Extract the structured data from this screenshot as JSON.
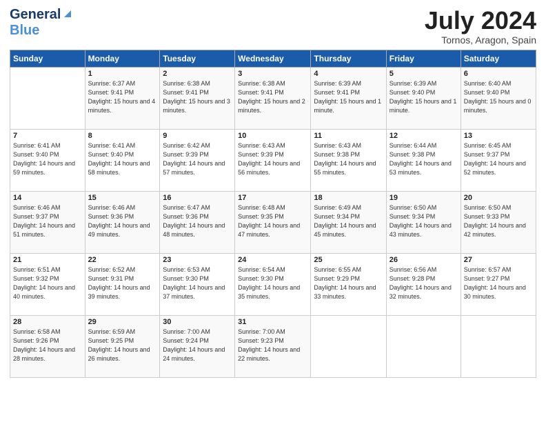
{
  "header": {
    "logo_general": "General",
    "logo_blue": "Blue",
    "month_title": "July 2024",
    "location": "Tornos, Aragon, Spain"
  },
  "days_of_week": [
    "Sunday",
    "Monday",
    "Tuesday",
    "Wednesday",
    "Thursday",
    "Friday",
    "Saturday"
  ],
  "weeks": [
    [
      {
        "day": "",
        "sunrise": "",
        "sunset": "",
        "daylight": ""
      },
      {
        "day": "1",
        "sunrise": "Sunrise: 6:37 AM",
        "sunset": "Sunset: 9:41 PM",
        "daylight": "Daylight: 15 hours and 4 minutes."
      },
      {
        "day": "2",
        "sunrise": "Sunrise: 6:38 AM",
        "sunset": "Sunset: 9:41 PM",
        "daylight": "Daylight: 15 hours and 3 minutes."
      },
      {
        "day": "3",
        "sunrise": "Sunrise: 6:38 AM",
        "sunset": "Sunset: 9:41 PM",
        "daylight": "Daylight: 15 hours and 2 minutes."
      },
      {
        "day": "4",
        "sunrise": "Sunrise: 6:39 AM",
        "sunset": "Sunset: 9:41 PM",
        "daylight": "Daylight: 15 hours and 1 minute."
      },
      {
        "day": "5",
        "sunrise": "Sunrise: 6:39 AM",
        "sunset": "Sunset: 9:40 PM",
        "daylight": "Daylight: 15 hours and 1 minute."
      },
      {
        "day": "6",
        "sunrise": "Sunrise: 6:40 AM",
        "sunset": "Sunset: 9:40 PM",
        "daylight": "Daylight: 15 hours and 0 minutes."
      }
    ],
    [
      {
        "day": "7",
        "sunrise": "Sunrise: 6:41 AM",
        "sunset": "Sunset: 9:40 PM",
        "daylight": "Daylight: 14 hours and 59 minutes."
      },
      {
        "day": "8",
        "sunrise": "Sunrise: 6:41 AM",
        "sunset": "Sunset: 9:40 PM",
        "daylight": "Daylight: 14 hours and 58 minutes."
      },
      {
        "day": "9",
        "sunrise": "Sunrise: 6:42 AM",
        "sunset": "Sunset: 9:39 PM",
        "daylight": "Daylight: 14 hours and 57 minutes."
      },
      {
        "day": "10",
        "sunrise": "Sunrise: 6:43 AM",
        "sunset": "Sunset: 9:39 PM",
        "daylight": "Daylight: 14 hours and 56 minutes."
      },
      {
        "day": "11",
        "sunrise": "Sunrise: 6:43 AM",
        "sunset": "Sunset: 9:38 PM",
        "daylight": "Daylight: 14 hours and 55 minutes."
      },
      {
        "day": "12",
        "sunrise": "Sunrise: 6:44 AM",
        "sunset": "Sunset: 9:38 PM",
        "daylight": "Daylight: 14 hours and 53 minutes."
      },
      {
        "day": "13",
        "sunrise": "Sunrise: 6:45 AM",
        "sunset": "Sunset: 9:37 PM",
        "daylight": "Daylight: 14 hours and 52 minutes."
      }
    ],
    [
      {
        "day": "14",
        "sunrise": "Sunrise: 6:46 AM",
        "sunset": "Sunset: 9:37 PM",
        "daylight": "Daylight: 14 hours and 51 minutes."
      },
      {
        "day": "15",
        "sunrise": "Sunrise: 6:46 AM",
        "sunset": "Sunset: 9:36 PM",
        "daylight": "Daylight: 14 hours and 49 minutes."
      },
      {
        "day": "16",
        "sunrise": "Sunrise: 6:47 AM",
        "sunset": "Sunset: 9:36 PM",
        "daylight": "Daylight: 14 hours and 48 minutes."
      },
      {
        "day": "17",
        "sunrise": "Sunrise: 6:48 AM",
        "sunset": "Sunset: 9:35 PM",
        "daylight": "Daylight: 14 hours and 47 minutes."
      },
      {
        "day": "18",
        "sunrise": "Sunrise: 6:49 AM",
        "sunset": "Sunset: 9:34 PM",
        "daylight": "Daylight: 14 hours and 45 minutes."
      },
      {
        "day": "19",
        "sunrise": "Sunrise: 6:50 AM",
        "sunset": "Sunset: 9:34 PM",
        "daylight": "Daylight: 14 hours and 43 minutes."
      },
      {
        "day": "20",
        "sunrise": "Sunrise: 6:50 AM",
        "sunset": "Sunset: 9:33 PM",
        "daylight": "Daylight: 14 hours and 42 minutes."
      }
    ],
    [
      {
        "day": "21",
        "sunrise": "Sunrise: 6:51 AM",
        "sunset": "Sunset: 9:32 PM",
        "daylight": "Daylight: 14 hours and 40 minutes."
      },
      {
        "day": "22",
        "sunrise": "Sunrise: 6:52 AM",
        "sunset": "Sunset: 9:31 PM",
        "daylight": "Daylight: 14 hours and 39 minutes."
      },
      {
        "day": "23",
        "sunrise": "Sunrise: 6:53 AM",
        "sunset": "Sunset: 9:30 PM",
        "daylight": "Daylight: 14 hours and 37 minutes."
      },
      {
        "day": "24",
        "sunrise": "Sunrise: 6:54 AM",
        "sunset": "Sunset: 9:30 PM",
        "daylight": "Daylight: 14 hours and 35 minutes."
      },
      {
        "day": "25",
        "sunrise": "Sunrise: 6:55 AM",
        "sunset": "Sunset: 9:29 PM",
        "daylight": "Daylight: 14 hours and 33 minutes."
      },
      {
        "day": "26",
        "sunrise": "Sunrise: 6:56 AM",
        "sunset": "Sunset: 9:28 PM",
        "daylight": "Daylight: 14 hours and 32 minutes."
      },
      {
        "day": "27",
        "sunrise": "Sunrise: 6:57 AM",
        "sunset": "Sunset: 9:27 PM",
        "daylight": "Daylight: 14 hours and 30 minutes."
      }
    ],
    [
      {
        "day": "28",
        "sunrise": "Sunrise: 6:58 AM",
        "sunset": "Sunset: 9:26 PM",
        "daylight": "Daylight: 14 hours and 28 minutes."
      },
      {
        "day": "29",
        "sunrise": "Sunrise: 6:59 AM",
        "sunset": "Sunset: 9:25 PM",
        "daylight": "Daylight: 14 hours and 26 minutes."
      },
      {
        "day": "30",
        "sunrise": "Sunrise: 7:00 AM",
        "sunset": "Sunset: 9:24 PM",
        "daylight": "Daylight: 14 hours and 24 minutes."
      },
      {
        "day": "31",
        "sunrise": "Sunrise: 7:00 AM",
        "sunset": "Sunset: 9:23 PM",
        "daylight": "Daylight: 14 hours and 22 minutes."
      },
      {
        "day": "",
        "sunrise": "",
        "sunset": "",
        "daylight": ""
      },
      {
        "day": "",
        "sunrise": "",
        "sunset": "",
        "daylight": ""
      },
      {
        "day": "",
        "sunrise": "",
        "sunset": "",
        "daylight": ""
      }
    ]
  ]
}
